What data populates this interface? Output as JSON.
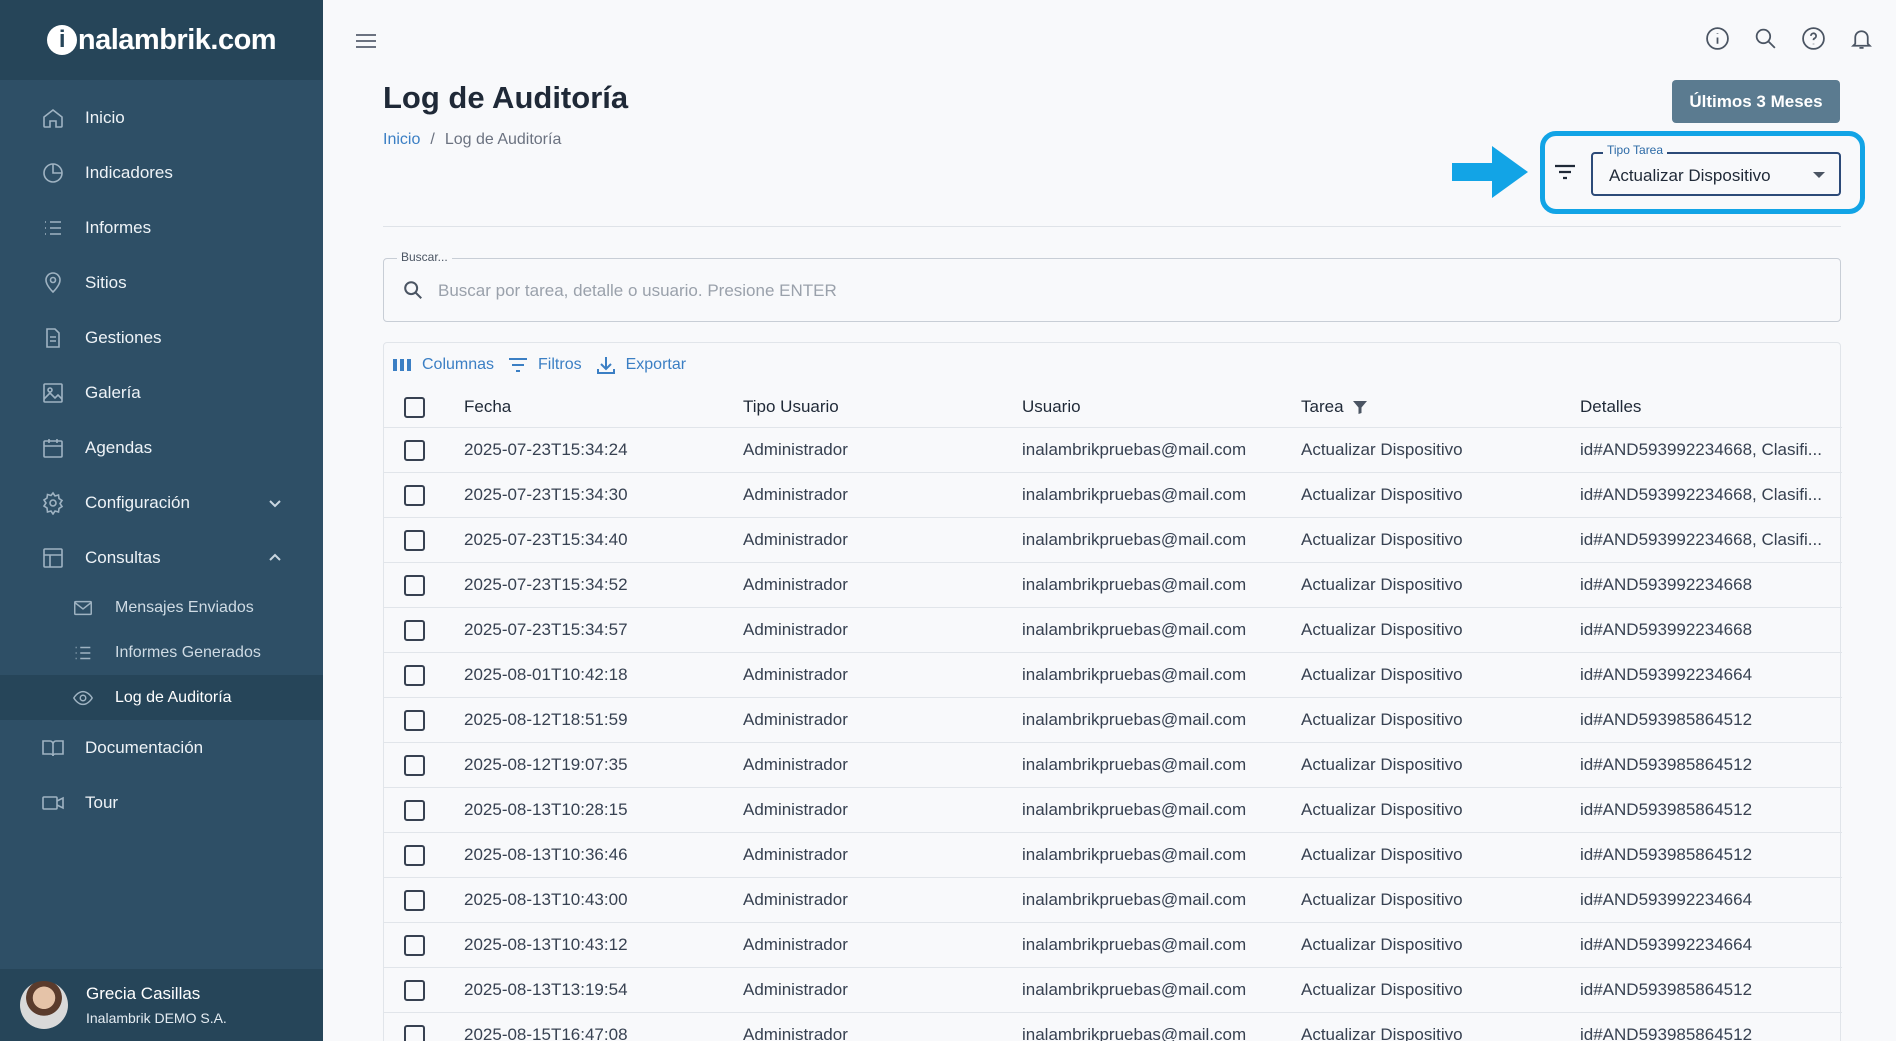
{
  "brand": {
    "name": "inalambrik.com",
    "initial": "i",
    "rest": "nalambrik.com"
  },
  "sidebar": {
    "items": [
      {
        "label": "Inicio",
        "icon": "home-icon"
      },
      {
        "label": "Indicadores",
        "icon": "pie-chart-icon"
      },
      {
        "label": "Informes",
        "icon": "list-icon"
      },
      {
        "label": "Sitios",
        "icon": "location-pin-icon"
      },
      {
        "label": "Gestiones",
        "icon": "document-icon"
      },
      {
        "label": "Galería",
        "icon": "image-icon"
      },
      {
        "label": "Agendas",
        "icon": "calendar-icon"
      },
      {
        "label": "Configuración",
        "icon": "gear-icon"
      },
      {
        "label": "Consultas",
        "icon": "table-icon"
      }
    ],
    "sub_items": [
      {
        "label": "Mensajes Enviados",
        "icon": "envelope-icon"
      },
      {
        "label": "Informes Generados",
        "icon": "list-icon"
      },
      {
        "label": "Log de Auditoría",
        "icon": "eye-icon",
        "active": true
      }
    ],
    "bottom_items": [
      {
        "label": "Documentación",
        "icon": "book-icon"
      },
      {
        "label": "Tour",
        "icon": "video-icon"
      }
    ]
  },
  "user": {
    "name": "Grecia Casillas",
    "org": "Inalambrik DEMO S.A."
  },
  "header": {
    "title": "Log de Auditoría",
    "breadcrumb": {
      "home": "Inicio",
      "separator": "/",
      "current": "Log de Auditoría"
    },
    "range_button": "Últimos 3 Meses"
  },
  "filter": {
    "label": "Tipo Tarea",
    "value": "Actualizar Dispositivo"
  },
  "search": {
    "label": "Buscar...",
    "placeholder": "Buscar por tarea, detalle o usuario. Presione ENTER"
  },
  "toolbar": {
    "columns": "Columnas",
    "filters": "Filtros",
    "export": "Exportar"
  },
  "table": {
    "headers": [
      "Fecha",
      "Tipo Usuario",
      "Usuario",
      "Tarea",
      "Detalles"
    ],
    "rows": [
      [
        "2025-07-23T15:34:24",
        "Administrador",
        "inalambrikpruebas@mail.com",
        "Actualizar Dispositivo",
        "id#AND593992234668, Clasifi..."
      ],
      [
        "2025-07-23T15:34:30",
        "Administrador",
        "inalambrikpruebas@mail.com",
        "Actualizar Dispositivo",
        "id#AND593992234668, Clasifi..."
      ],
      [
        "2025-07-23T15:34:40",
        "Administrador",
        "inalambrikpruebas@mail.com",
        "Actualizar Dispositivo",
        "id#AND593992234668, Clasifi..."
      ],
      [
        "2025-07-23T15:34:52",
        "Administrador",
        "inalambrikpruebas@mail.com",
        "Actualizar Dispositivo",
        "id#AND593992234668"
      ],
      [
        "2025-07-23T15:34:57",
        "Administrador",
        "inalambrikpruebas@mail.com",
        "Actualizar Dispositivo",
        "id#AND593992234668"
      ],
      [
        "2025-08-01T10:42:18",
        "Administrador",
        "inalambrikpruebas@mail.com",
        "Actualizar Dispositivo",
        "id#AND593992234664"
      ],
      [
        "2025-08-12T18:51:59",
        "Administrador",
        "inalambrikpruebas@mail.com",
        "Actualizar Dispositivo",
        "id#AND593985864512"
      ],
      [
        "2025-08-12T19:07:35",
        "Administrador",
        "inalambrikpruebas@mail.com",
        "Actualizar Dispositivo",
        "id#AND593985864512"
      ],
      [
        "2025-08-13T10:28:15",
        "Administrador",
        "inalambrikpruebas@mail.com",
        "Actualizar Dispositivo",
        "id#AND593985864512"
      ],
      [
        "2025-08-13T10:36:46",
        "Administrador",
        "inalambrikpruebas@mail.com",
        "Actualizar Dispositivo",
        "id#AND593985864512"
      ],
      [
        "2025-08-13T10:43:00",
        "Administrador",
        "inalambrikpruebas@mail.com",
        "Actualizar Dispositivo",
        "id#AND593992234664"
      ],
      [
        "2025-08-13T10:43:12",
        "Administrador",
        "inalambrikpruebas@mail.com",
        "Actualizar Dispositivo",
        "id#AND593992234664"
      ],
      [
        "2025-08-13T13:19:54",
        "Administrador",
        "inalambrikpruebas@mail.com",
        "Actualizar Dispositivo",
        "id#AND593985864512"
      ],
      [
        "2025-08-15T16:47:08",
        "Administrador",
        "inalambrikpruebas@mail.com",
        "Actualizar Dispositivo",
        "id#AND593985864512"
      ]
    ]
  },
  "colors": {
    "sidebar": "#2e4f66",
    "sidebar_dark": "#264559",
    "accent": "#3b7fc4",
    "highlight": "#12a4e6",
    "range_button": "#5b7b90"
  }
}
